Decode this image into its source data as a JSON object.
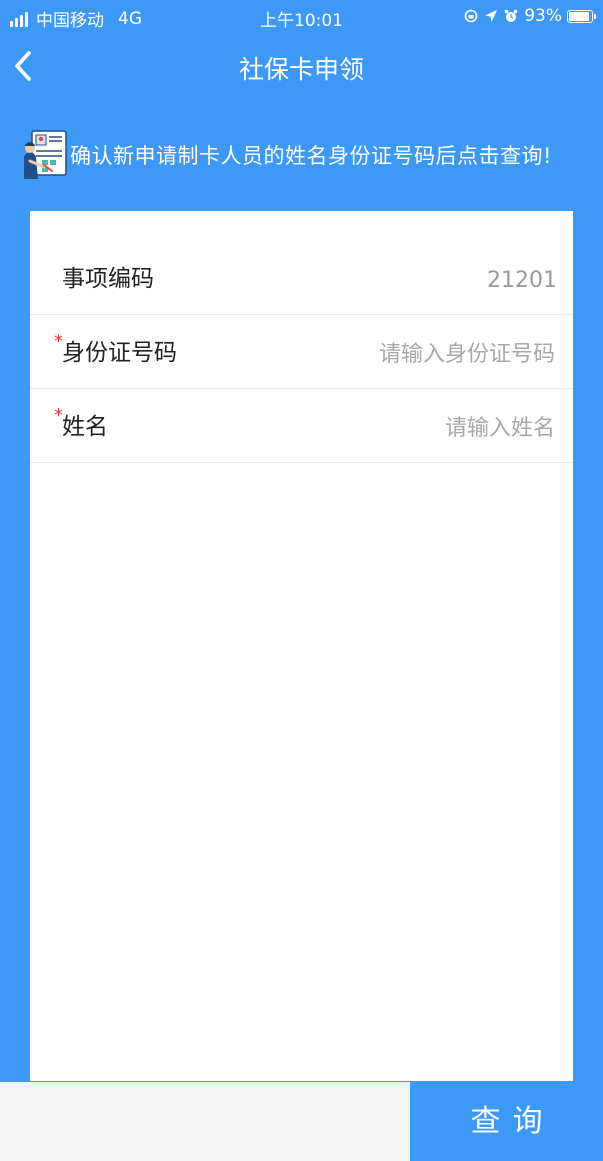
{
  "status_bar": {
    "carrier": "中国移动",
    "network": "4G",
    "time": "上午10:01",
    "battery_percent": "93%",
    "battery_level": 0.93
  },
  "nav": {
    "title": "社保卡申领",
    "back_icon": "chevron-left-icon"
  },
  "hint": {
    "icon": "id-form-icon",
    "text": "确认新申请制卡人员的姓名身份证号码后点击查询!"
  },
  "form": {
    "item_code": {
      "label": "事项编码",
      "value": "21201"
    },
    "id_number": {
      "required_mark": "*",
      "label": "身份证号码",
      "placeholder": "请输入身份证号码"
    },
    "name": {
      "required_mark": "*",
      "label": "姓名",
      "placeholder": "请输入姓名"
    }
  },
  "actions": {
    "query_label": "查询"
  },
  "colors": {
    "primary": "#3d99f5",
    "required": "#e53935",
    "card": "#ffffff",
    "bottom_left": "#f3f3f3"
  }
}
